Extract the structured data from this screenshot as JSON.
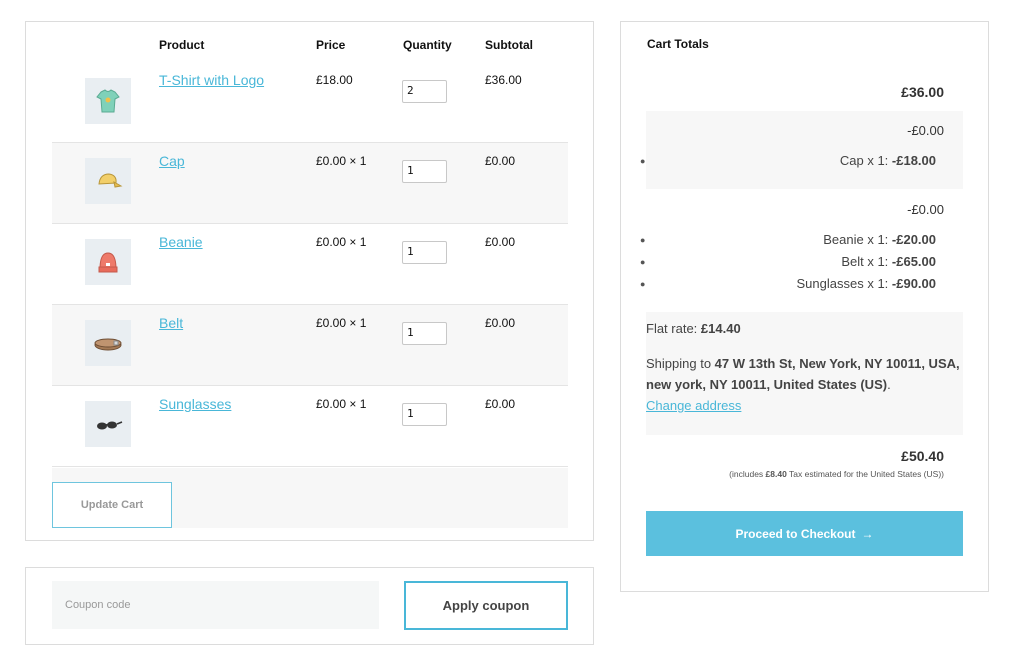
{
  "cart": {
    "headers": {
      "product": "Product",
      "price": "Price",
      "quantity": "Quantity",
      "subtotal": "Subtotal"
    },
    "items": [
      {
        "name": "T-Shirt with Logo",
        "price": "£18.00",
        "qty": "2",
        "subtotal": "£36.00",
        "icon": "tshirt-icon"
      },
      {
        "name": "Cap",
        "price": "£0.00 × 1",
        "qty": "1",
        "subtotal": "£0.00",
        "icon": "cap-icon"
      },
      {
        "name": "Beanie",
        "price": "£0.00 × 1",
        "qty": "1",
        "subtotal": "£0.00",
        "icon": "beanie-icon"
      },
      {
        "name": "Belt",
        "price": "£0.00 × 1",
        "qty": "1",
        "subtotal": "£0.00",
        "icon": "belt-icon"
      },
      {
        "name": "Sunglasses",
        "price": "£0.00 × 1",
        "qty": "1",
        "subtotal": "£0.00",
        "icon": "sunglasses-icon"
      }
    ],
    "update_label": "Update Cart"
  },
  "coupon": {
    "placeholder": "Coupon code",
    "apply_label": "Apply coupon"
  },
  "totals": {
    "title": "Cart Totals",
    "subtotal": "£36.00",
    "discount_group_1": {
      "amount": "-£0.00",
      "lines": [
        {
          "label": "Cap x 1: ",
          "value": "-£18.00"
        }
      ]
    },
    "discount_group_2": {
      "amount": "-£0.00",
      "lines": [
        {
          "label": "Beanie x 1: ",
          "value": "-£20.00"
        },
        {
          "label": "Belt x 1: ",
          "value": "-£65.00"
        },
        {
          "label": "Sunglasses x 1: ",
          "value": "-£90.00"
        }
      ]
    },
    "shipping": {
      "flat_rate_label": "Flat rate: ",
      "flat_rate_value": "£14.40",
      "ship_to_prefix": "Shipping to ",
      "address": "47 W 13th St, New York, NY 10011, USA, new york, NY 10011, United States (US)",
      "ship_to_suffix": ".",
      "change_address": "Change address"
    },
    "order_total": "£50.40",
    "tax_note_prefix": "(includes ",
    "tax_note_value": "£8.40",
    "tax_note_suffix": " Tax estimated for the United States (US))",
    "checkout_label": "Proceed to Checkout",
    "checkout_arrow": "→",
    "colors": {
      "accent": "#5bc0de",
      "link": "#49b7d8"
    }
  }
}
